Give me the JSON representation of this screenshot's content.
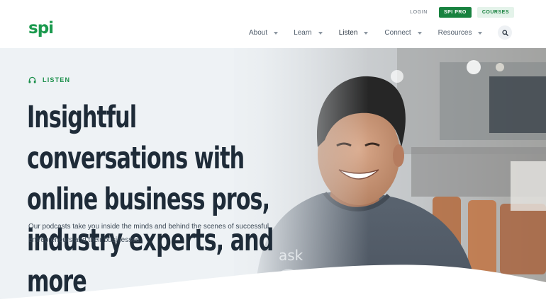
{
  "brand": {
    "logo_text": "spi",
    "accent": "#1b9a4e"
  },
  "utility_nav": {
    "login_label": "LOGIN",
    "pro_label": "SPI PRO",
    "courses_label": "COURSES"
  },
  "main_nav": {
    "items": [
      {
        "label": "About",
        "icon": "chevron-down-icon"
      },
      {
        "label": "Learn",
        "icon": "chevron-down-icon"
      },
      {
        "label": "Listen",
        "icon": "chevron-down-icon"
      },
      {
        "label": "Connect",
        "icon": "chevron-down-icon"
      },
      {
        "label": "Resources",
        "icon": "chevron-down-icon"
      }
    ],
    "search_icon": "search-icon"
  },
  "hero": {
    "eyebrow_icon": "headphones-icon",
    "eyebrow_label": "LISTEN",
    "headline": "Insightful conversations with online business pros, industry experts, and more",
    "subtext": "Our podcasts take you inside the minds and behind the scenes of successful entrepreneurs and their businesses."
  }
}
